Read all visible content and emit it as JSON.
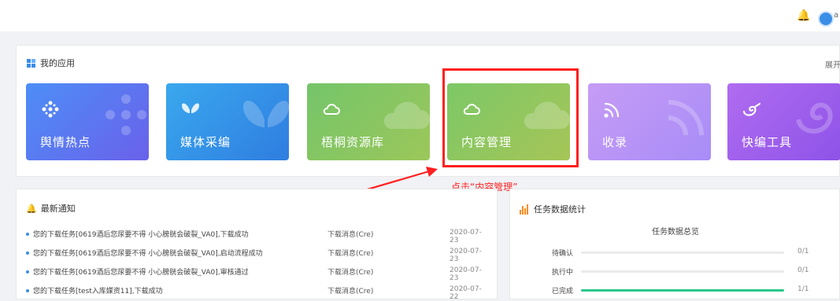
{
  "header": {
    "user_initial": "a",
    "bell_icon": "bell-icon"
  },
  "apps": {
    "title": "我的应用",
    "expand_label": "展开",
    "tiles": [
      {
        "label": "舆情热点",
        "icon": "network-icon"
      },
      {
        "label": "媒体采编",
        "icon": "butterfly-icon"
      },
      {
        "label": "梧桐资源库",
        "icon": "cloud-icon"
      },
      {
        "label": "内容管理",
        "icon": "cloud-icon"
      },
      {
        "label": "收录",
        "icon": "signal-icon"
      },
      {
        "label": "快编工具",
        "icon": "swirl-icon"
      }
    ]
  },
  "annotation": {
    "text": "点击“内容管理”",
    "color": "#ff2020"
  },
  "notices": {
    "title": "最新通知",
    "rows": [
      {
        "message": "您的下载任务[0619酒后您尿要不得 小心膀胱会破裂_VA0],下载成功",
        "source": "下载消息(Cre)",
        "date": "2020-07-23"
      },
      {
        "message": "您的下载任务[0619酒后您尿要不得 小心膀胱会破裂_VA0],启动流程成功",
        "source": "下载消息(Cre)",
        "date": "2020-07-23"
      },
      {
        "message": "您的下载任务[0619酒后您尿要不得 小心膀胱会破裂_VA0],审核通过",
        "source": "下载消息(Cre)",
        "date": "2020-07-23"
      },
      {
        "message": "您的下载任务[test入库媒资11],下载成功",
        "source": "下载消息(Cre)",
        "date": "2020-07-22"
      }
    ]
  },
  "stats": {
    "title": "任务数据统计",
    "subtitle": "任务数据总览",
    "rows": [
      {
        "label": "待确认",
        "count": "0/1",
        "fraction": 0
      },
      {
        "label": "执行中",
        "count": "0/1",
        "fraction": 0
      },
      {
        "label": "已完成",
        "count": "1/1",
        "fraction": 1
      }
    ]
  }
}
